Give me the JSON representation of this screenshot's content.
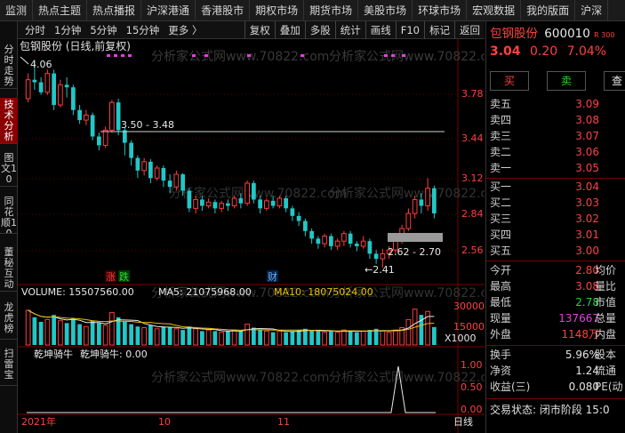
{
  "topbar": {
    "items": [
      "监测",
      "热点主题",
      "热点播报",
      "沪深港通",
      "香港股市",
      "期权市场",
      "期货市场",
      "美股市场",
      "环球市场",
      "宏观数据",
      "我的版面",
      "沪深"
    ]
  },
  "lefttabs": [
    {
      "label": "分时走势",
      "active": false
    },
    {
      "label": "技术分析",
      "active": true
    },
    {
      "label": "图文10",
      "active": false
    },
    {
      "label": "同花顺10",
      "active": false
    },
    {
      "label": "董秘互动",
      "active": false
    },
    {
      "label": "龙虎榜",
      "active": false
    },
    {
      "label": "扫雷宝",
      "active": false
    }
  ],
  "toolbar": {
    "left": [
      "分时",
      "1分钟",
      "5分钟",
      "15分钟",
      "更多 〉"
    ],
    "right": [
      "复权",
      "叠加",
      "多股",
      "统计",
      "画线",
      "F10",
      "标记",
      "返回"
    ]
  },
  "chart": {
    "header": "包钢股份 (日线,前复权)",
    "watermark": "分析家公式网www.70822.com",
    "annot_high": "4.06",
    "annot_range1": "3.50 - 3.48",
    "annot_range2": "2.62 - 2.70",
    "annot_low": "2.41",
    "marker_zhang": "涨",
    "marker_die": "跌",
    "marker_cai": "财",
    "price_axis": [
      "3.78",
      "3.44",
      "3.12",
      "2.84",
      "2.56"
    ],
    "vol_label": "VOLUME: 15507560.00",
    "ma5_label": "MA5: 21075968.00",
    "ma10_label": "MA10: 18075024.00",
    "vol_axis": [
      "30000",
      "15000"
    ],
    "vol_unit": "X1000",
    "ind_label1": "乾坤骑牛",
    "ind_label2": "乾坤骑牛: 0.00",
    "ind_axis": [
      "1.00",
      "0.50",
      "0.00"
    ],
    "date_labels": [
      "2021年",
      "10",
      "11"
    ],
    "corner_label": "日线"
  },
  "chart_data": {
    "type": "candlestick",
    "price_range": [
      2.41,
      4.06
    ],
    "candles": [
      [
        3.75,
        3.9,
        3.72,
        3.95
      ],
      [
        3.9,
        3.88,
        3.82,
        4.06
      ],
      [
        3.88,
        3.8,
        3.78,
        3.92
      ],
      [
        3.8,
        3.95,
        3.78,
        3.98
      ],
      [
        3.95,
        3.7,
        3.66,
        3.98
      ],
      [
        3.7,
        3.86,
        3.68,
        3.9
      ],
      [
        3.86,
        3.84,
        3.76,
        3.92
      ],
      [
        3.84,
        3.66,
        3.62,
        3.86
      ],
      [
        3.66,
        3.58,
        3.55,
        3.7
      ],
      [
        3.58,
        3.62,
        3.54,
        3.66
      ],
      [
        3.62,
        3.45,
        3.42,
        3.64
      ],
      [
        3.45,
        3.38,
        3.34,
        3.48
      ],
      [
        3.38,
        3.5,
        3.36,
        3.53
      ],
      [
        3.5,
        3.72,
        3.48,
        3.74
      ],
      [
        3.72,
        3.5,
        3.46,
        3.75
      ],
      [
        3.5,
        3.4,
        3.3,
        3.52
      ],
      [
        3.4,
        3.28,
        3.22,
        3.42
      ],
      [
        3.28,
        3.18,
        3.12,
        3.3
      ],
      [
        3.18,
        3.25,
        3.14,
        3.28
      ],
      [
        3.25,
        3.12,
        3.08,
        3.27
      ],
      [
        3.12,
        3.2,
        3.1,
        3.22
      ],
      [
        3.2,
        3.1,
        3.05,
        3.22
      ],
      [
        3.1,
        3.05,
        3.0,
        3.15
      ],
      [
        3.05,
        3.15,
        3.02,
        3.18
      ],
      [
        3.15,
        3.02,
        2.98,
        3.16
      ],
      [
        3.02,
        2.88,
        2.85,
        3.04
      ],
      [
        2.88,
        2.95,
        2.84,
        2.98
      ],
      [
        2.95,
        2.9,
        2.86,
        2.98
      ],
      [
        2.9,
        2.93,
        2.88,
        2.96
      ],
      [
        2.93,
        2.88,
        2.84,
        2.95
      ],
      [
        2.88,
        2.92,
        2.85,
        2.94
      ],
      [
        2.92,
        2.9,
        2.86,
        2.95
      ],
      [
        2.9,
        2.96,
        2.88,
        2.98
      ],
      [
        2.96,
        2.92,
        2.88,
        3.0
      ],
      [
        2.92,
        3.08,
        2.9,
        3.1
      ],
      [
        3.08,
        2.95,
        2.92,
        3.1
      ],
      [
        2.95,
        2.88,
        2.84,
        2.98
      ],
      [
        2.88,
        2.94,
        2.86,
        2.96
      ],
      [
        2.94,
        2.9,
        2.88,
        2.98
      ],
      [
        2.9,
        2.96,
        2.88,
        2.98
      ],
      [
        2.96,
        2.88,
        2.85,
        2.98
      ],
      [
        2.88,
        2.82,
        2.78,
        2.9
      ],
      [
        2.82,
        2.78,
        2.74,
        2.85
      ],
      [
        2.78,
        2.7,
        2.66,
        2.8
      ],
      [
        2.7,
        2.64,
        2.6,
        2.72
      ],
      [
        2.64,
        2.6,
        2.56,
        2.66
      ],
      [
        2.6,
        2.66,
        2.57,
        2.68
      ],
      [
        2.66,
        2.58,
        2.55,
        2.68
      ],
      [
        2.58,
        2.62,
        2.55,
        2.64
      ],
      [
        2.62,
        2.68,
        2.58,
        2.7
      ],
      [
        2.68,
        2.6,
        2.57,
        2.7
      ],
      [
        2.6,
        2.58,
        2.54,
        2.62
      ],
      [
        2.58,
        2.62,
        2.56,
        2.66
      ],
      [
        2.62,
        2.52,
        2.48,
        2.64
      ],
      [
        2.52,
        2.48,
        2.44,
        2.55
      ],
      [
        2.48,
        2.52,
        2.41,
        2.56
      ],
      [
        2.52,
        2.55,
        2.48,
        2.58
      ],
      [
        2.55,
        2.62,
        2.52,
        2.66
      ],
      [
        2.62,
        2.72,
        2.6,
        2.75
      ],
      [
        2.72,
        2.84,
        2.7,
        2.88
      ],
      [
        2.84,
        2.95,
        2.8,
        2.98
      ],
      [
        2.95,
        2.9,
        2.84,
        3.0
      ],
      [
        2.9,
        3.04,
        2.86,
        3.12
      ],
      [
        3.04,
        2.84,
        2.8,
        3.06
      ]
    ],
    "volume_range": [
      0,
      40000
    ],
    "volumes": [
      30000,
      24000,
      20000,
      22000,
      26000,
      21000,
      19000,
      23000,
      18000,
      16000,
      21000,
      19000,
      17000,
      28000,
      24000,
      20000,
      18000,
      16000,
      15000,
      17000,
      14000,
      16000,
      15000,
      14000,
      13000,
      16000,
      14000,
      12000,
      13000,
      12000,
      11000,
      12000,
      13000,
      12000,
      18000,
      15000,
      13000,
      12000,
      11000,
      12000,
      11000,
      12000,
      13000,
      14000,
      13000,
      12000,
      11000,
      12000,
      11000,
      13000,
      12000,
      11000,
      12000,
      13000,
      14000,
      12000,
      11000,
      13000,
      15000,
      22000,
      31000,
      26000,
      29000,
      15500
    ]
  },
  "panel": {
    "name": "包钢股份",
    "code": "600010",
    "code_suffix": "R 300",
    "price": "3.04",
    "change": "0.20",
    "pct": "7.04%",
    "buy_btn": "买",
    "sell_btn": "卖",
    "other_btn": "查",
    "asks": [
      {
        "label": "卖五",
        "price": "3.09"
      },
      {
        "label": "卖四",
        "price": "3.08"
      },
      {
        "label": "卖三",
        "price": "3.07"
      },
      {
        "label": "卖二",
        "price": "3.06"
      },
      {
        "label": "卖一",
        "price": "3.05"
      }
    ],
    "bids": [
      {
        "label": "买一",
        "price": "3.04"
      },
      {
        "label": "买二",
        "price": "3.03"
      },
      {
        "label": "买三",
        "price": "3.02"
      },
      {
        "label": "买四",
        "price": "3.01"
      },
      {
        "label": "买五",
        "price": "3.00"
      }
    ],
    "stats": [
      {
        "label": "今开",
        "value": "2.80",
        "cls": "red",
        "label2": "均价"
      },
      {
        "label": "最高",
        "value": "3.08",
        "cls": "red",
        "label2": "量比"
      },
      {
        "label": "最低",
        "value": "2.78",
        "cls": "green",
        "label2": "市值"
      },
      {
        "label": "现量",
        "value": "137667",
        "cls": "magenta",
        "label2": "总量"
      },
      {
        "label": "外盘",
        "value": "1148万",
        "cls": "red",
        "label2": "内盘"
      }
    ],
    "stats2": [
      {
        "label": "换手",
        "value": "5.96%",
        "cls": "white",
        "label2": "股本"
      },
      {
        "label": "净资",
        "value": "1.24",
        "cls": "white",
        "label2": "流通"
      },
      {
        "label": "收益(三)",
        "value": "0.080",
        "cls": "white",
        "label2": "PE(动"
      }
    ],
    "status": "交易状态: 闭市阶段 15:0"
  },
  "colors": {
    "up": "#ff3c3c",
    "down": "#22c7c7",
    "ma5": "#e8e8e8",
    "ma10": "#e8c000",
    "ind": "#e8e8e8",
    "grid": "#5a0000"
  }
}
